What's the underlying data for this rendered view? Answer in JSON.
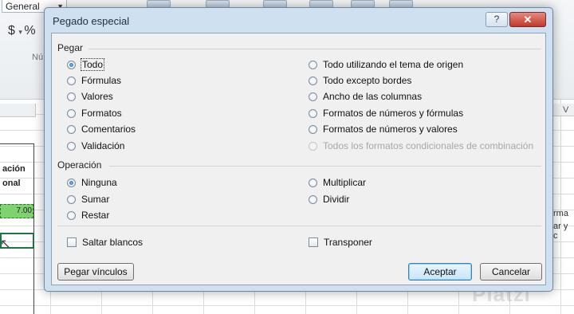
{
  "excel": {
    "number_format": "General",
    "currency_symbol": "$",
    "number_group_label": "Nú",
    "column_right_label": "V",
    "cells": {
      "header_line1": "ación",
      "header_line2": "onal",
      "value": "7.00",
      "right_text_1": "rma",
      "right_text_2": "ar y c"
    },
    "watermark": "Platzi"
  },
  "dialog": {
    "title": "Pegado especial",
    "help_label": "?",
    "close_label": "✕",
    "pegar": {
      "label": "Pegar",
      "options_left": [
        {
          "label": "Todo",
          "selected": true
        },
        {
          "label": "Fórmulas",
          "selected": false
        },
        {
          "label": "Valores",
          "selected": false
        },
        {
          "label": "Formatos",
          "selected": false
        },
        {
          "label": "Comentarios",
          "selected": false
        },
        {
          "label": "Validación",
          "selected": false
        }
      ],
      "options_right": [
        {
          "label": "Todo utilizando el tema de origen",
          "selected": false
        },
        {
          "label": "Todo excepto bordes",
          "selected": false
        },
        {
          "label": "Ancho de las columnas",
          "selected": false
        },
        {
          "label": "Formatos de números y fórmulas",
          "selected": false
        },
        {
          "label": "Formatos de números y valores",
          "selected": false
        },
        {
          "label": "Todos los formatos condicionales de combinación",
          "selected": false,
          "disabled": true
        }
      ]
    },
    "operacion": {
      "label": "Operación",
      "options_left": [
        {
          "label": "Ninguna",
          "selected": true
        },
        {
          "label": "Sumar",
          "selected": false
        },
        {
          "label": "Restar",
          "selected": false
        }
      ],
      "options_right": [
        {
          "label": "Multiplicar",
          "selected": false
        },
        {
          "label": "Dividir",
          "selected": false
        }
      ]
    },
    "checkboxes": {
      "saltar_blancos": {
        "label": "Saltar blancos",
        "checked": false
      },
      "transponer": {
        "label": "Transponer",
        "checked": false
      }
    },
    "buttons": {
      "pegar_vinculos": "Pegar vínculos",
      "aceptar": "Aceptar",
      "cancelar": "Cancelar"
    }
  }
}
